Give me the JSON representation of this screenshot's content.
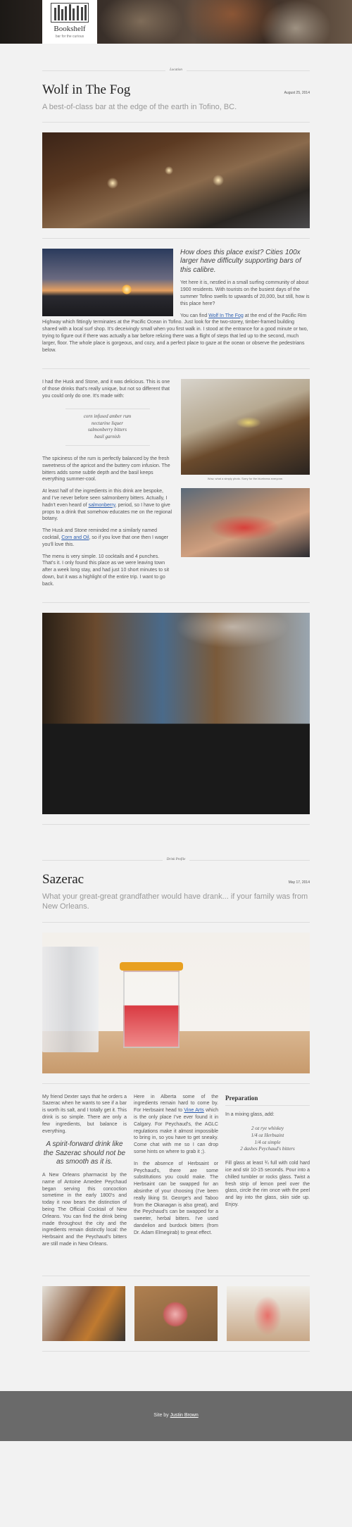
{
  "site": {
    "name": "Bookshelf",
    "tagline": "bar for the curious"
  },
  "article1": {
    "category": "Location",
    "title": "Wolf in The Fog",
    "date": "August 25, 2014",
    "subtitle": "A best-of-class bar at the edge of the earth in Tofino, BC.",
    "intro_lead": "How does this place exist? Cities 100x larger have difficulty supporting bars of this calibre.",
    "intro_p1": "Yet here it is, nestled in a small surfing community of about 1900 residents. With tourists on the busiest days of the summer Tofino swells to upwards of 20,000, but still, how is this place here?",
    "intro_p2_before": "You can find ",
    "intro_p2_link": "Wolf In The Fog",
    "intro_p2_after": " at the end of the Pacific Rim Highway which fittingly terminates at the Pacific Ocean in Tofino. Just look for the two-storey, timber-framed building shared with a local surf shop. It's deceivingly small when you first walk in. I stood at the entrance for a good minute or two, trying to figure out if there was actually a bar before relizing there was a flight of steps that led up to the second, much larger, floor. The whole place is gorgeous, and cozy, and a perfect place to gaze at the ocean or observe the pedestrians below.",
    "drink_p1": "I had the Husk and Stone, and it was delicious. This is one of those drinks that's really unique, but not so different that you could only do one. It's made with:",
    "ingredients": [
      "corn infused amber rum",
      "nectarine liquer",
      "salmonberry bitters",
      "basil garnish"
    ],
    "drink_p2": "The spiciness of the rum is perfectly balanced by the fresh sweetness of the apricot and the buttery corn infusion. The bitters adds some subtle depth and the basil keeps everything summer-cool.",
    "drink_p3_before": "At least half of the ingredients in this drink are bespoke, and I've never before seen salmonberry bitters. Actually, I hadn't even heard of ",
    "drink_p3_link": "salmonberry",
    "drink_p3_after": ", period, so I have to give props to a drink that somehow educates me on the regional botany.",
    "drink_p4_before": "The Husk and Stone reminded me a similarly named cocktail, ",
    "drink_p4_link": "Corn and Oil",
    "drink_p4_after": ", so if you love that one then I wager you'll love this.",
    "drink_p5": "The menu is very simple. 10 cocktails and 4 punches. That's it. I only found this place as we were leaving town after a week long stay, and had just 10 short minutes to sit down, but it was a highlight of the entire trip. I want to go back.",
    "photo_caption": "Wow, what a simply photo. Sorry for the blurriness everyone."
  },
  "article2": {
    "category": "Drink Profile",
    "title": "Sazerac",
    "date": "May 17, 2014",
    "subtitle": "What your great-great grandfather would have drank... if your family was from New Orleans.",
    "col1_p1": "My friend Dexter says that he orders a Sazerac when he wants to see if a bar is worth its salt, and I totally get it. This drink is so simple. There are only a few ingredients, but balance is everything.",
    "pull_quote": "A spirit-forward drink like the Sazerac should not be as smooth as it is.",
    "col1_p2": "A New Orleans pharmacist by the name of Antoine Amedee Peychaud began serving this concoction sometime in the early 1800's and today it now bears the distinction of being The Official Cocktail of New Orleans. You can find the drink being made throughout the city and the ingredients remain distinctly local: the Herbsaint and the Peychaud's bitters are still made in New Orleans.",
    "col2_p1_before": "Here in Alberta some of the ingredients remain hard to come by. For Herbsaint head to ",
    "col2_p1_link": "Vine Arts",
    "col2_p1_after": " which is the only place I've ever found it in Calgary. For Peychaud's, the AGLC regulations make it almost impossible to bring in, so you have to get sneaky. Come chat with me so I can drop some hints on where to grab it ;).",
    "col2_p2": "In the absence of Herbsaint or Peychaud's, there are some substitutions you could make. The Herbsaint can be swapped for an absinthe of your choosing (I've been really liking St. George's and Taboo from the Okanagan is also great), and the Peychaud's can be swapped for a sweeter, herbal bitters. I've used dandelion and burdock bitters (from Dr. Adam Elmegirab) to great effect.",
    "prep_title": "Preparation",
    "prep_intro": "In a mixing glass, add:",
    "prep_items": [
      "2 oz rye whiskey",
      "1/4 oz Herbsaint",
      "1/4 oz simple",
      "2 dashes Peychaud's bitters"
    ],
    "prep_steps": "Fill glass at least ¾ full with cold hard ice and stir 10-15 seconds. Pour into a chilled tumbler or rocks glass. Twist a fresh strip of lemon peel over the glass, circle the rim once with the peel and lay into the glass, skin side up. Enjoy."
  },
  "footer": {
    "prefix": "Site by ",
    "author": "Justin Brown"
  }
}
